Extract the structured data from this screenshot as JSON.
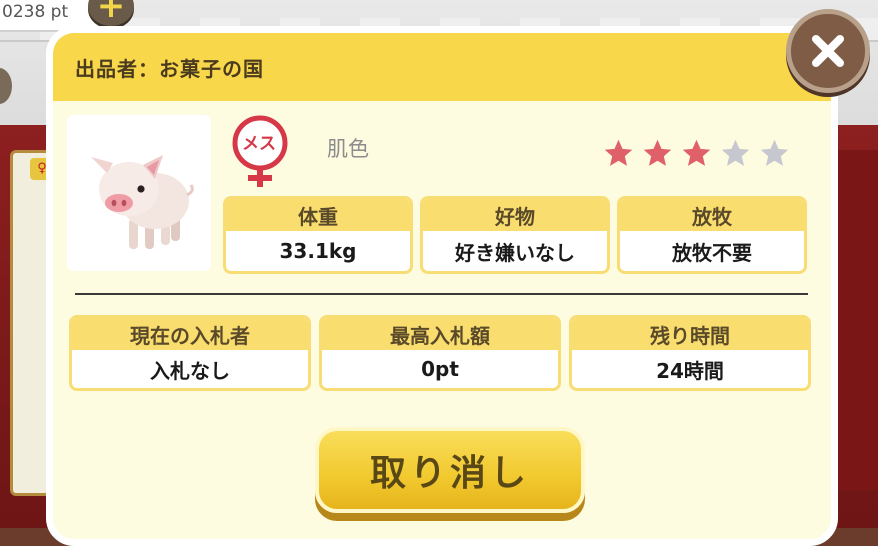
{
  "hud": {
    "points": "0238 pt",
    "add_icon": "plus-icon"
  },
  "dialog": {
    "seller": "出品者：お菓子の国",
    "close_icon": "close-icon"
  },
  "pet": {
    "image": "pig-icon",
    "gender": "メス",
    "gender_icon": "female-icon",
    "color": "肌色",
    "rating": 3,
    "rating_max": 5,
    "colors": {
      "star_on": "#e0606a",
      "star_off": "#c7c7cf"
    },
    "stats": [
      {
        "label": "体重",
        "value": "33.1kg"
      },
      {
        "label": "好物",
        "value": "好き嫌いなし"
      },
      {
        "label": "放牧",
        "value": "放牧不要"
      }
    ]
  },
  "auction": [
    {
      "label": "現在の入札者",
      "value": "入札なし"
    },
    {
      "label": "最高入札額",
      "value": "0pt"
    },
    {
      "label": "残り時間",
      "value": "24時間"
    }
  ],
  "actions": {
    "cancel": "取り消し"
  },
  "colors": {
    "header": "#f8d74a",
    "dialog_bg": "#fdfbe0",
    "accent_red": "#d63848"
  }
}
